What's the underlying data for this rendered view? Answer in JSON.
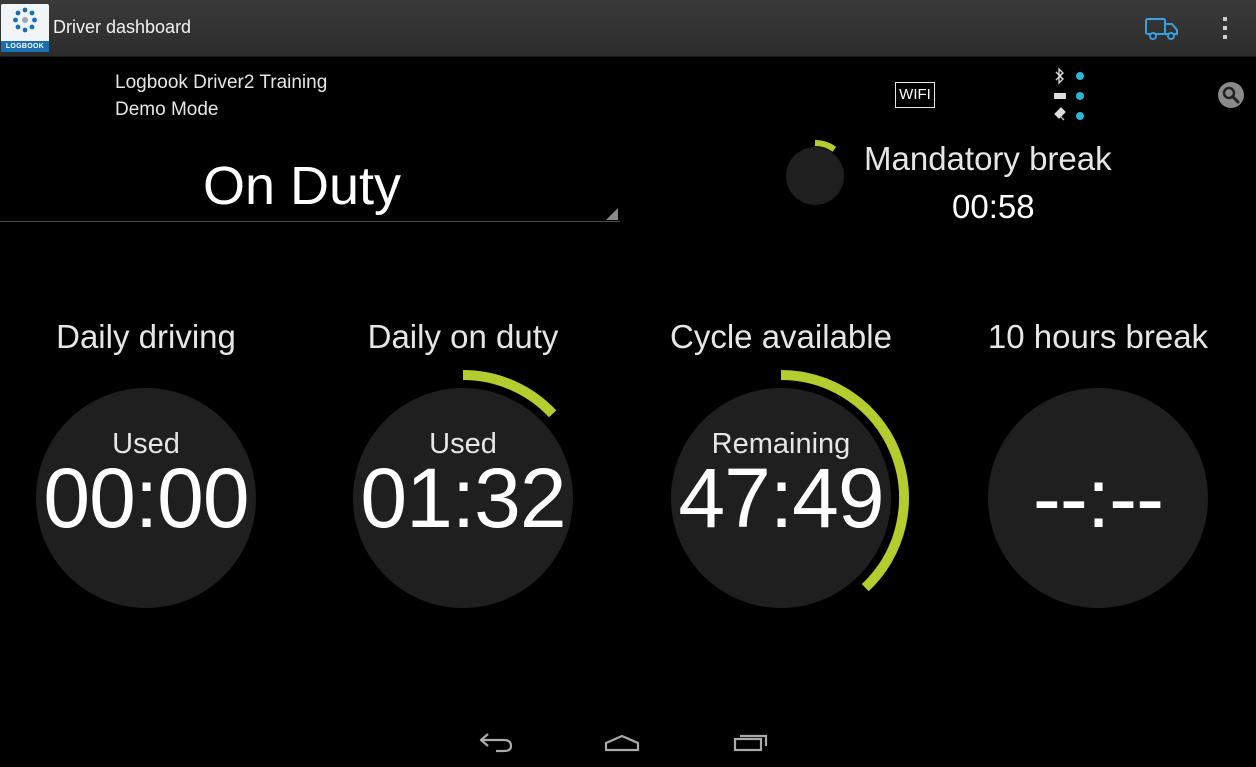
{
  "action_bar": {
    "logo_text": "LOGBOOK",
    "title": "Driver dashboard"
  },
  "header": {
    "user_line": "Logbook  Driver2 Training",
    "mode_line": "Demo Mode",
    "wifi_label": "WIFI"
  },
  "duty": {
    "status": "On Duty"
  },
  "mandatory_break": {
    "label": "Mandatory break",
    "time": "00:58",
    "progress": 0.1
  },
  "gauges": [
    {
      "title": "Daily driving",
      "sublabel": "Used",
      "value": "00:00",
      "progress": 0
    },
    {
      "title": "Daily on duty",
      "sublabel": "Used",
      "value": "01:32",
      "progress": 0.13
    },
    {
      "title": "Cycle available",
      "sublabel": "Remaining",
      "value": "47:49",
      "progress": 0.38
    },
    {
      "title": "10 hours break",
      "sublabel": "",
      "value": "--:--",
      "progress": 0
    }
  ],
  "colors": {
    "accent": "#b5cc2e",
    "circle": "#1f1f1f",
    "wifi_dot": "#29b6d6",
    "truck": "#3aa0e0"
  }
}
